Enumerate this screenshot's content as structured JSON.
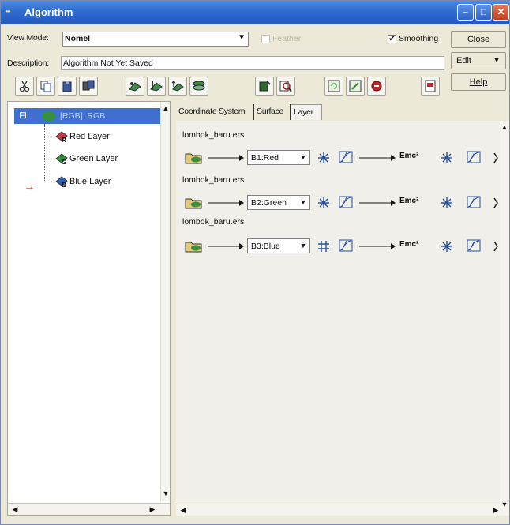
{
  "window": {
    "title": "Algorithm",
    "icon_text": "•••",
    "minimize": "–",
    "maximize": "□",
    "close": "✕"
  },
  "view_mode": {
    "label": "View Mode:",
    "value": "Nomel"
  },
  "feather": {
    "label": "Feather",
    "checked": false,
    "enabled": false
  },
  "smoothing": {
    "label": "Smoothing",
    "checked": true,
    "check_glyph": "✔"
  },
  "description": {
    "label": "Description:",
    "value": "Algorithm Not Yet Saved"
  },
  "side_buttons": {
    "close": "Close",
    "edit": "Edit",
    "edit_arrow": "▼",
    "help": "Help"
  },
  "dropdown_arrow": "▼",
  "tree": {
    "root_label": "[RGB]: RGB",
    "root_toggle": "⊟",
    "items": [
      {
        "label": "Red Layer",
        "badge": "R",
        "color": "#c93b3b"
      },
      {
        "label": "Green Layer",
        "badge": "G",
        "color": "#2f8f3a"
      },
      {
        "label": "Blue Layer",
        "badge": "B",
        "color": "#2f5fb8"
      }
    ],
    "pointer": "→"
  },
  "tabs": [
    "Coordinate System",
    "Surface",
    "Layer"
  ],
  "layers": [
    {
      "file": "lombok_baru.ers",
      "band": "B1:Red",
      "emc": "Emc²"
    },
    {
      "file": "lombok_baru.ers",
      "band": "B2:Green",
      "emc": "Emc²"
    },
    {
      "file": "lombok_baru.ers",
      "band": "B3:Blue",
      "emc": "Emc²"
    }
  ],
  "scroll": {
    "left": "◀",
    "right": "▶",
    "up": "▲",
    "down": "▼"
  }
}
